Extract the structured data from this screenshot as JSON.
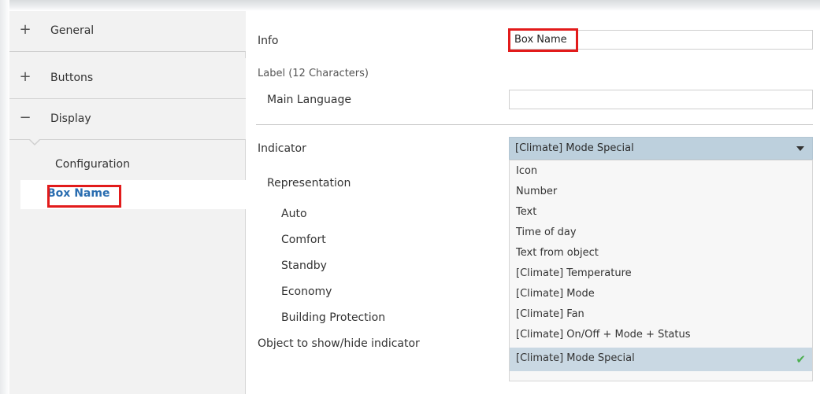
{
  "sidebar": {
    "items": [
      {
        "symbol": "+",
        "label": "General",
        "icon": "plus-icon"
      },
      {
        "symbol": "+",
        "label": "Buttons",
        "icon": "plus-icon"
      },
      {
        "symbol": "−",
        "label": "Display",
        "icon": "minus-icon"
      }
    ],
    "subitems": [
      {
        "label": "Configuration"
      },
      {
        "label": "Box Name",
        "active": true
      }
    ]
  },
  "content": {
    "info": {
      "label": "Info",
      "value": "Box Name"
    },
    "label_section": {
      "heading": "Label (12 Characters)"
    },
    "main_language": {
      "label": "Main Language",
      "value": ""
    },
    "indicator": {
      "label": "Indicator",
      "selected": "[Climate] Mode Special"
    },
    "representation": {
      "label": "Representation"
    },
    "modes": [
      "Auto",
      "Comfort",
      "Standby",
      "Economy",
      "Building Protection"
    ],
    "object_show_hide": {
      "label": "Object to show/hide indicator"
    },
    "dropdown_options": [
      "Icon",
      "Number",
      "Text",
      "Time of day",
      "Text from object",
      "[Climate] Temperature",
      "[Climate] Mode",
      "[Climate] Fan",
      "[Climate] On/Off + Mode + Status",
      "[Climate] Mode Special"
    ],
    "selected_option_index": 9,
    "check_icon": "check-icon"
  },
  "colors": {
    "highlight": "#e21b1b",
    "active_link": "#2a6db0",
    "select_bg": "#bdd0dd",
    "check": "#4caf50"
  }
}
